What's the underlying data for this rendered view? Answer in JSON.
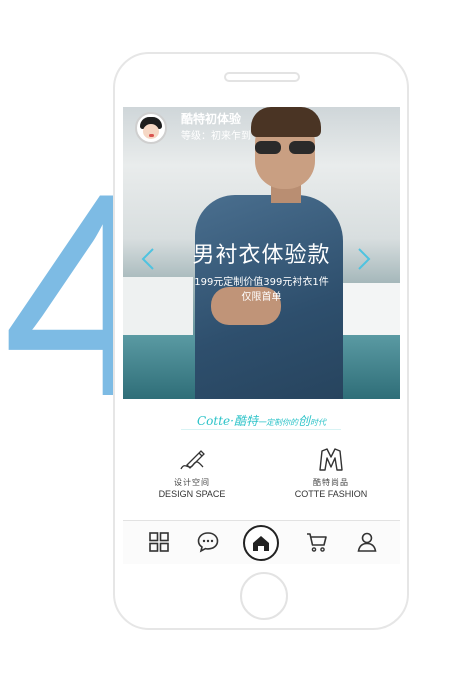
{
  "step_number": "4",
  "user": {
    "name": "酷特初体验",
    "level": "等级：初来乍到"
  },
  "banner": {
    "title": "男衬衣体验款",
    "subtitle": "199元定制价值399元衬衣1件",
    "note": "仅限首单"
  },
  "slogan": {
    "brand": "Cotte·酷特",
    "tagline": "一定制你的",
    "highlight": "创",
    "ending": "时代"
  },
  "features": [
    {
      "cn": "设计空间",
      "en": "DESIGN SPACE",
      "icon": "pen-signature-icon"
    },
    {
      "cn": "酷特尚品",
      "en": "COTTE FASHION",
      "icon": "shirt-m-icon"
    }
  ],
  "tabbar": {
    "icons": [
      "grid-icon",
      "chat-bubble-icon",
      "home-icon",
      "cart-icon",
      "user-icon"
    ]
  },
  "colors": {
    "accent_blue": "#7dbbe4",
    "slogan_teal": "#2cc3c8",
    "phone_border": "#e6e6e6"
  }
}
